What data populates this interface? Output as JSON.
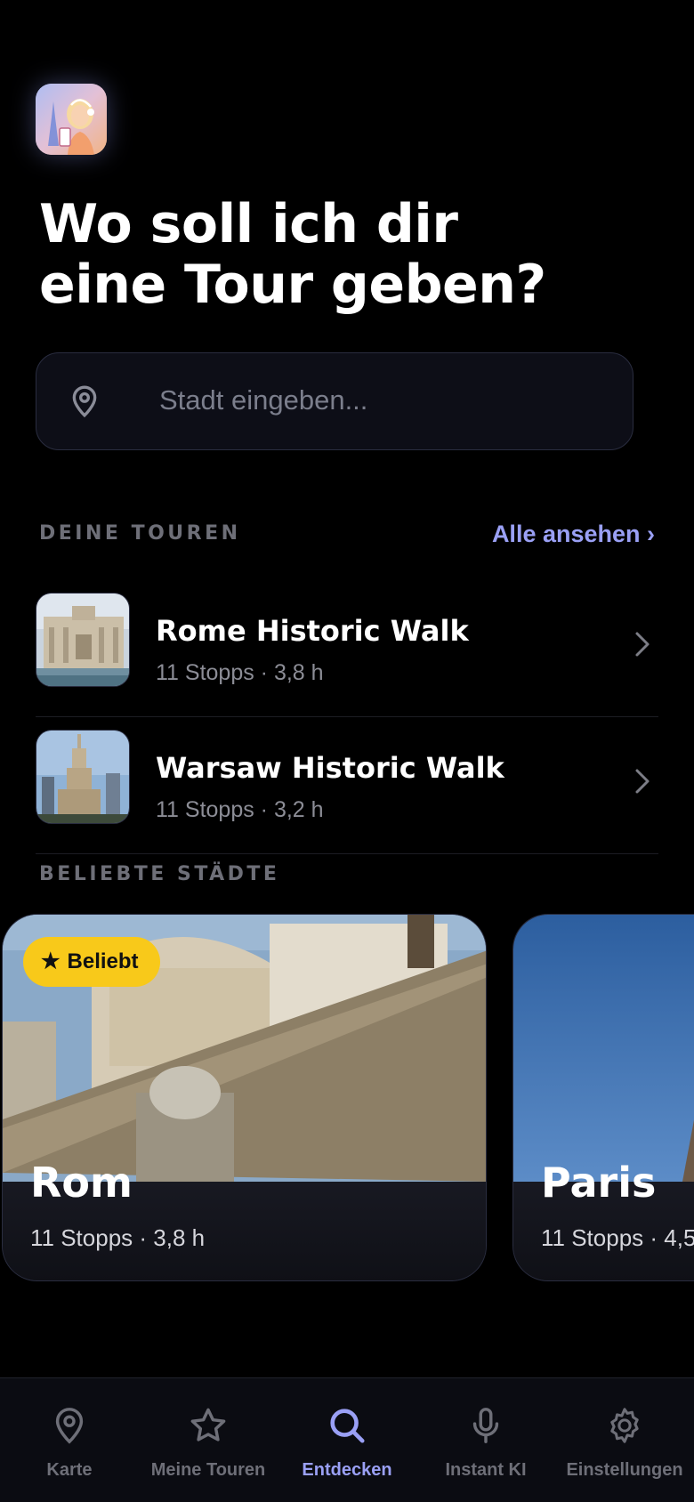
{
  "header": {
    "headline_line1": "Wo soll ich dir",
    "headline_line2": "eine Tour geben?"
  },
  "search": {
    "placeholder": "Stadt eingeben...",
    "value": "",
    "icon": "location-pin-icon"
  },
  "your_tours": {
    "label": "DEINE TOUREN",
    "see_all": "Alle ansehen ›",
    "items": [
      {
        "title": "Rome Historic Walk",
        "meta": "11 Stopps · 3,8 h"
      },
      {
        "title": "Warsaw Historic Walk",
        "meta": "11 Stopps · 3,2 h"
      }
    ]
  },
  "popular_cities": {
    "label": "BELIEBTE STÄDTE",
    "cards": [
      {
        "name": "Rom",
        "meta": "11 Stopps · 3,8 h",
        "badge": "Beliebt"
      },
      {
        "name": "Paris",
        "meta": "11 Stopps · 4,5"
      }
    ]
  },
  "tabbar": {
    "tabs": [
      {
        "label": "Karte",
        "icon": "map-pin-icon"
      },
      {
        "label": "Meine Touren",
        "icon": "star-icon"
      },
      {
        "label": "Entdecken",
        "icon": "search-icon",
        "active": true
      },
      {
        "label": "Instant KI",
        "icon": "microphone-icon"
      },
      {
        "label": "Einstellungen",
        "icon": "gear-icon"
      }
    ]
  },
  "colors": {
    "background": "#000000",
    "accent": "#9aa0f5",
    "badge": "#f8c91a",
    "muted": "#6e6f78"
  }
}
